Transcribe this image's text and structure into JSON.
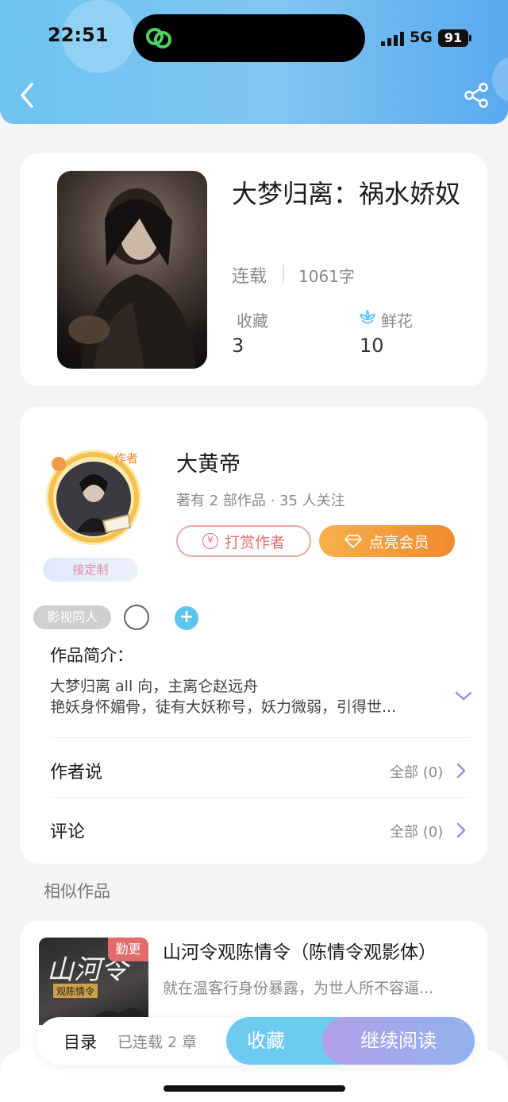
{
  "status_bar": {
    "time": "22:51",
    "network": "5G",
    "battery": "91"
  },
  "book": {
    "title": "大梦归离：祸水娇奴",
    "status": "连载",
    "word_count": "1061字",
    "favorites_label": "收藏",
    "favorites_count": "3",
    "flowers_label": "鲜花",
    "flowers_count": "10"
  },
  "author": {
    "badge": "作者",
    "name": "大黄帝",
    "meta": "著有 2 部作品 · 35 人关注",
    "tip_button": "打赏作者",
    "vip_button": "点亮会员",
    "custom_tag": "接定制"
  },
  "tags": {
    "genre": "影视同人",
    "add": "+"
  },
  "intro": {
    "label": "作品简介：",
    "line1": "大梦归离 all 向，主离仑赵远舟",
    "line2": "艳妖身怀媚骨，徒有大妖称号，妖力微弱，引得世..."
  },
  "rows": {
    "author_says": {
      "label": "作者说",
      "value": "全部 (0)"
    },
    "comments": {
      "label": "评论",
      "value": "全部 (0)"
    }
  },
  "similar": {
    "title": "相似作品",
    "items": [
      {
        "badge": "勤更",
        "cover_text": "山河令",
        "cover_sub": "观陈情令",
        "name": "山河令观陈情令（陈情令观影体）",
        "desc": "就在温客行身份暴露，为世人所不容逼..."
      }
    ]
  },
  "bottom": {
    "toc": "目录",
    "chapters": "已连载 2 章",
    "favorite": "收藏",
    "continue": "继续阅读"
  },
  "colors": {
    "header": "#6ec3f0",
    "accent_blue": "#5cc5ee",
    "vip_orange": "#ef8a2e",
    "tip_red": "#e06e6e",
    "badge_red": "#e36a6a"
  },
  "icons": [
    "back-arrow-icon",
    "share-icon",
    "link-app-icon",
    "signal-icon",
    "battery-icon",
    "flower-icon",
    "yuan-icon",
    "diamond-icon",
    "chevron-down-icon",
    "chevron-right-icon"
  ]
}
